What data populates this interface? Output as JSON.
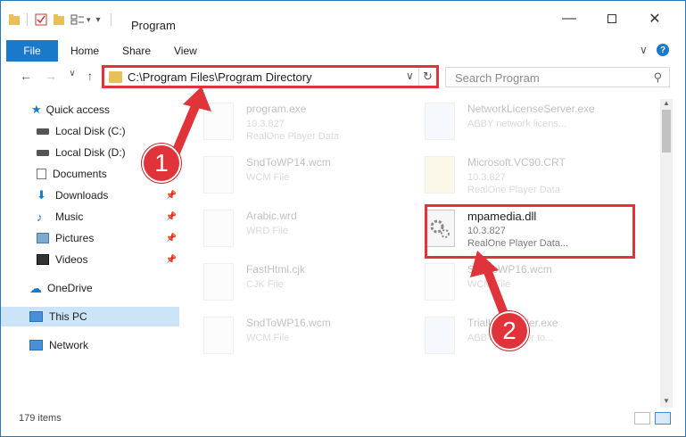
{
  "title": "Program",
  "ribbon": {
    "file": "File",
    "home": "Home",
    "share": "Share",
    "view": "View"
  },
  "address": {
    "path": "C:\\Program Files\\Program Directory"
  },
  "search": {
    "placeholder": "Search Program"
  },
  "sidebar": {
    "items": [
      {
        "label": "Quick access",
        "icon": "star-icon"
      },
      {
        "label": "Local Disk (C:)",
        "icon": "drive-icon"
      },
      {
        "label": "Local Disk (D:)",
        "icon": "drive-icon"
      },
      {
        "label": "Documents",
        "icon": "documents-icon"
      },
      {
        "label": "Downloads",
        "icon": "download-icon"
      },
      {
        "label": "Music",
        "icon": "music-icon"
      },
      {
        "label": "Pictures",
        "icon": "pictures-icon"
      },
      {
        "label": "Videos",
        "icon": "videos-icon"
      },
      {
        "label": "OneDrive",
        "icon": "cloud-icon"
      },
      {
        "label": "This PC",
        "icon": "computer-icon"
      },
      {
        "label": "Network",
        "icon": "network-icon"
      }
    ]
  },
  "files": [
    {
      "name": "program.exe",
      "line2": "10.3.827",
      "line3": "RealOne Player Data"
    },
    {
      "name": "NetworkLicenseServer.exe",
      "line2": "ABBY network licens...",
      "line3": ""
    },
    {
      "name": "SndToWP14.wcm",
      "line2": "WCM File",
      "line3": ""
    },
    {
      "name": "Microsoft.VC90.CRT",
      "line2": "10.3.827",
      "line3": "RealOne Player Data"
    },
    {
      "name": "Arabic.wrd",
      "line2": "WRD File",
      "line3": ""
    },
    {
      "name": "mpamedia.dll",
      "line2": "10.3.827",
      "line3": "RealOne Player Data..."
    },
    {
      "name": "FastHtml.cjk",
      "line2": "CJK File",
      "line3": ""
    },
    {
      "name": "SndToWP16.wcm",
      "line2": "WCM File",
      "line3": ""
    },
    {
      "name": "SndToWP16.wcm",
      "line2": "WCM File",
      "line3": ""
    },
    {
      "name": "TrialUninstaller.exe",
      "line2": "ABBY uploader to...",
      "line3": ""
    }
  ],
  "status": {
    "count": "179 items"
  },
  "callouts": {
    "one": "1",
    "two": "2"
  },
  "colors": {
    "accent": "#1979ca",
    "highlight": "#e0343a"
  }
}
